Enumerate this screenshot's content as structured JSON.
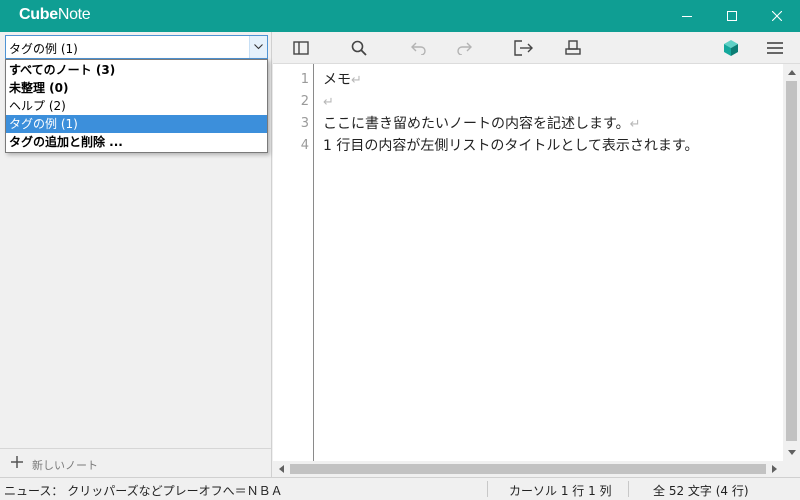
{
  "app": {
    "title_part1": "Cube",
    "title_part2": "Note",
    "colors": {
      "titlebar": "#0f9e93",
      "selection": "#3c8fdb",
      "cube_icon": "#14a89c"
    }
  },
  "window_controls": [
    "minimize-icon",
    "maximize-icon",
    "close-icon"
  ],
  "tag_select": {
    "value": "タグの例 (1)",
    "options": [
      {
        "label": "すべてのノート (3)",
        "bold": true
      },
      {
        "label": "未整理 (0)",
        "bold": true
      },
      {
        "label": "ヘルプ (2)",
        "bold": false
      },
      {
        "label": "タグの例 (1)",
        "bold": false,
        "selected": true
      },
      {
        "label": "タグの追加と削除 ...",
        "bold": true
      }
    ]
  },
  "new_note": {
    "label": "新しいノート"
  },
  "toolbar_icons": [
    "sidebar-toggle-icon",
    "search-icon",
    "undo-icon",
    "redo-icon",
    "export-icon",
    "print-icon",
    "cube-icon",
    "menu-icon"
  ],
  "editor": {
    "line_numbers": [
      "1",
      "2",
      "3",
      "4"
    ],
    "lines": [
      "メモ",
      "",
      "ここに書き留めたいノートの内容を記述します。",
      "1 行目の内容が左側リストのタイトルとして表示されます。"
    ],
    "eol_mark": "↵"
  },
  "status": {
    "news": "ニュース： クリッパーズなどプレーオフへ＝ＮＢＡ",
    "cursor": "カーソル 1 行 1 列",
    "count": "全 52 文字 (4 行)"
  }
}
